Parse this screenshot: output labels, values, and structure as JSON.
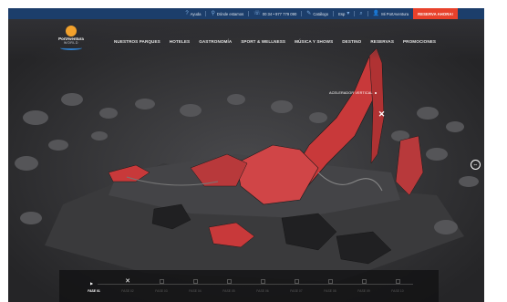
{
  "topbar": {
    "items": [
      {
        "icon": "help-icon",
        "label": "Ayuda"
      },
      {
        "icon": "location-icon",
        "label": "Dónde estamos"
      },
      {
        "icon": "phone-icon",
        "label": "00 34 • 977 779 090"
      },
      {
        "icon": "language-icon",
        "label": "Catálogo"
      },
      {
        "icon": "",
        "label": "Esp"
      },
      {
        "icon": "search-icon",
        "label": ""
      },
      {
        "icon": "user-icon",
        "label": "Mi PortAventura"
      }
    ],
    "reserve_label": "RESERVA AHORA!"
  },
  "logo": {
    "line1": "PortAventura",
    "line2": "WORLD"
  },
  "menu": [
    "NUESTROS PARQUES",
    "HOTELES",
    "GASTRONOMÍA",
    "SPORT & WELLNESS",
    "MÚSICA Y SHOWS",
    "DESTINO",
    "RESERVAS",
    "PROMOCIONES"
  ],
  "scene": {
    "attraction_label": "ACELERADOR VERTICAL",
    "hotspot_symbol": "✕",
    "next_symbol": "⇔"
  },
  "timeline": {
    "phases": [
      "FASE 01",
      "FASE 02",
      "FASE 03",
      "FASE 04",
      "FASE 05",
      "FASE 06",
      "FASE 07",
      "FASE 08",
      "FASE 09",
      "FASE 10"
    ],
    "active_index": 0
  },
  "colors": {
    "topbar": "#1c3e6b",
    "reserve": "#e8412b",
    "structure": "#c8393a",
    "ground": "#2f2f31"
  }
}
